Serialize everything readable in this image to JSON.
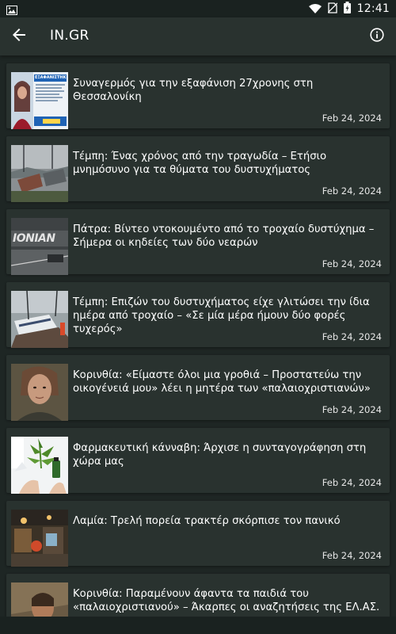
{
  "status_bar": {
    "time": "12:41"
  },
  "app_bar": {
    "title": "IN.GR"
  },
  "articles": [
    {
      "title": "Συναγερμός για την εξαφάνιση 27χρονης στη Θεσσαλονίκη",
      "date": "Feb 24, 2024",
      "thumb_text": "ΕΞΑΦΑΝΙΣΤΗΚΕ"
    },
    {
      "title": "Τέμπη: Ένας χρόνος από την τραγωδία – Ετήσιο μνημόσυνο για τα θύματα του δυστυχήματος",
      "date": "Feb 24, 2024"
    },
    {
      "title": "Πάτρα: Βίντεο ντοκουμέντο από το τροχαίο δυστύχημα – Σήμερα οι κηδείες των δύο νεαρών",
      "date": "Feb 24, 2024",
      "thumb_text": "ΙΟΝΙΑΝ"
    },
    {
      "title": "Τέμπη: Επιζών του δυστυχήματος είχε γλιτώσει την ίδια ημέρα από τροχαίο – «Σε μία μέρα ήμουν δύο φορές τυχερός»",
      "date": "Feb 24, 2024"
    },
    {
      "title": "Κορινθία: «Είμαστε όλοι μια γροθιά – Προστατεύω την οικογένειά μου» λέει η μητέρα των «παλαιοχριστιανών»",
      "date": "Feb 24, 2024"
    },
    {
      "title": "Φαρμακευτική κάνναβη: Άρχισε η συνταγογράφηση στη χώρα μας",
      "date": "Feb 24, 2024"
    },
    {
      "title": "Λαμία: Τρελή πορεία τρακτέρ σκόρπισε τον πανικό",
      "date": "Feb 24, 2024"
    },
    {
      "title": "Κορινθία: Παραμένουν άφαντα τα παιδιά του «παλαιοχριστιανού» – Άκαρπες οι αναζητήσεις της ΕΛ.ΑΣ.",
      "date": ""
    }
  ]
}
